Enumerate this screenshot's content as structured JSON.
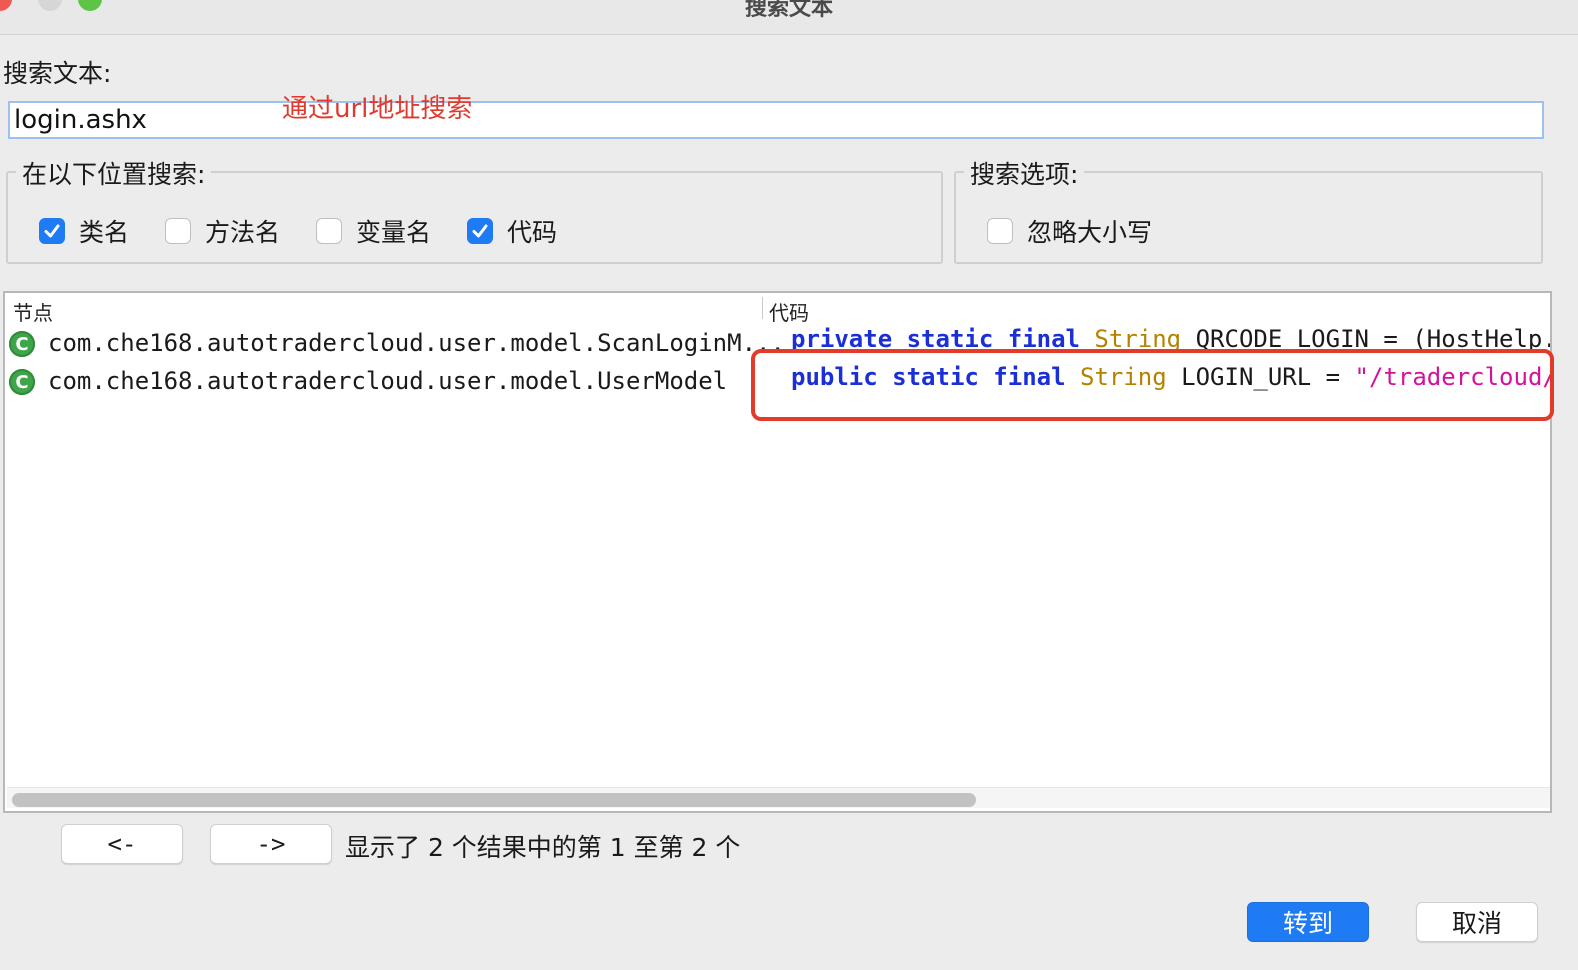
{
  "window": {
    "title": "搜索文本"
  },
  "search": {
    "label": "搜索文本:",
    "value": "login.ashx",
    "annotation": "通过url地址搜索"
  },
  "location_group": {
    "title": "在以下位置搜索:",
    "options": [
      {
        "label": "类名",
        "checked": true
      },
      {
        "label": "方法名",
        "checked": false
      },
      {
        "label": "变量名",
        "checked": false
      },
      {
        "label": "代码",
        "checked": true
      }
    ]
  },
  "options_group": {
    "title": "搜索选项:",
    "options": [
      {
        "label": "忽略大小写",
        "checked": false
      }
    ]
  },
  "results": {
    "columns": [
      "节点",
      "代码"
    ],
    "rows": [
      {
        "icon": "class-icon",
        "node": "com.che168.autotradercloud.user.model.ScanLoginM...",
        "code": [
          {
            "t": "private static final",
            "k": "kw"
          },
          {
            "t": " String",
            "k": "typ"
          },
          {
            "t": " QRCODE_LOGIN = (HostHelp.HO",
            "k": "plain"
          }
        ]
      },
      {
        "icon": "class-icon",
        "node": "com.che168.autotradercloud.user.model.UserModel",
        "code": [
          {
            "t": "public static final",
            "k": "kw"
          },
          {
            "t": " String",
            "k": "typ"
          },
          {
            "t": " LOGIN_URL = ",
            "k": "plain"
          },
          {
            "t": "\"/tradercloud/se",
            "k": "str"
          }
        ]
      }
    ]
  },
  "pagination": {
    "prev_label": "<-",
    "next_label": "->",
    "status": "显示了 2 个结果中的第 1 至第 2 个"
  },
  "buttons": {
    "goto": "转到",
    "cancel": "取消"
  },
  "colors": {
    "accent": "#1f7bf4",
    "annotation": "#e03a2e",
    "keyword": "#1b2fd6",
    "type": "#b38300",
    "string": "#d3139a"
  }
}
